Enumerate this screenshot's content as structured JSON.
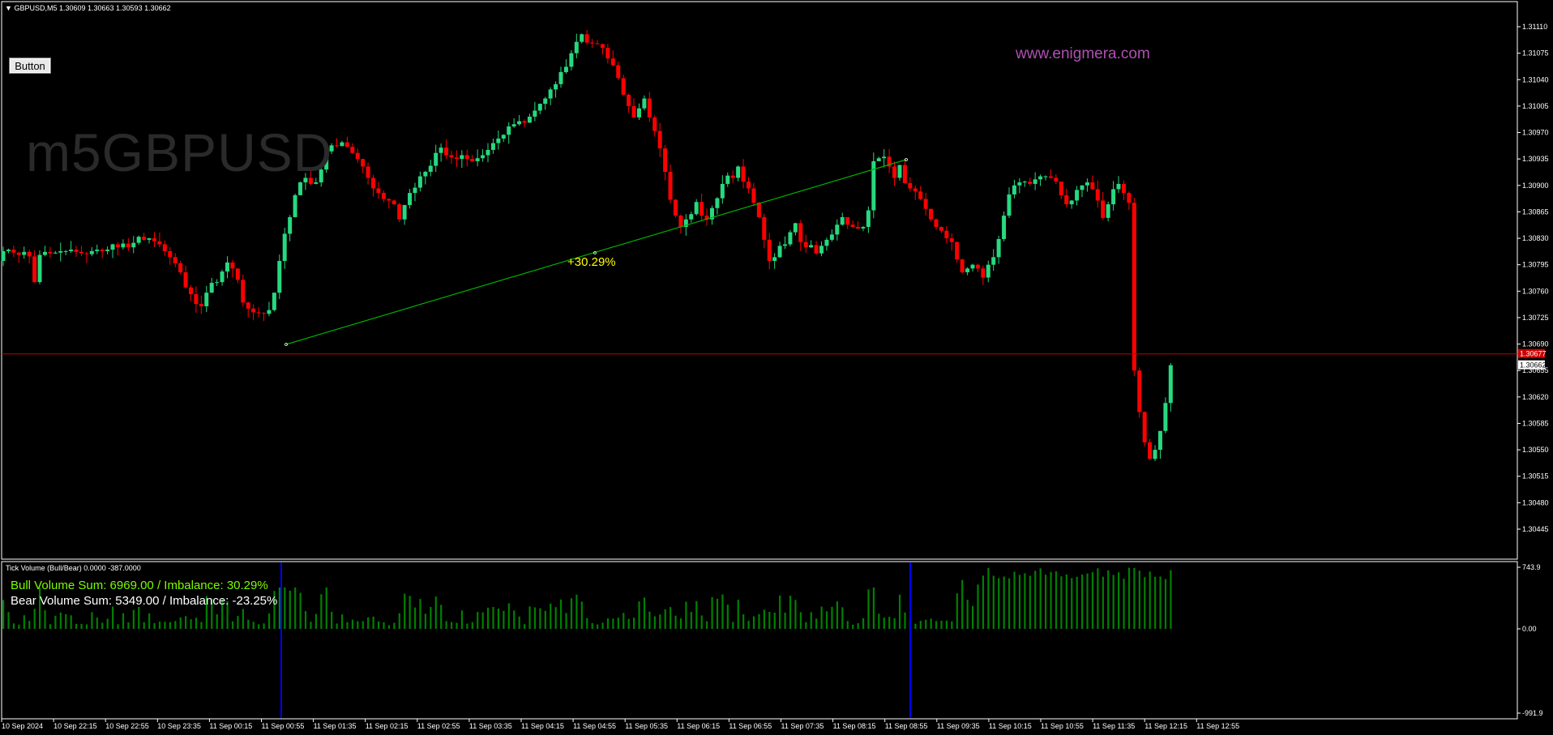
{
  "header": {
    "menu_arrow": "▼",
    "symbol": "GBPUSD,M5",
    "ohlc": "1.30609 1.30663 1.30593 1.30662"
  },
  "button_label": "Button",
  "watermark": "m5GBPUSD",
  "website": "www.enigmera.com",
  "imbalance_annotation": "+30.29%",
  "price_scale": {
    "ticks": [
      "1.31110",
      "1.31075",
      "1.31040",
      "1.31005",
      "1.30970",
      "1.30935",
      "1.30900",
      "1.30865",
      "1.30830",
      "1.30795",
      "1.30760",
      "1.30725",
      "1.30690",
      "1.30655",
      "1.30620",
      "1.30585",
      "1.30550",
      "1.30515",
      "1.30480",
      "1.30445"
    ],
    "ask_label": "1.30677",
    "bid_label": "1.30662"
  },
  "time_axis": [
    "10 Sep 2024",
    "10 Sep 22:15",
    "10 Sep 22:55",
    "10 Sep 23:35",
    "11 Sep 00:15",
    "11 Sep 00:55",
    "11 Sep 01:35",
    "11 Sep 02:15",
    "11 Sep 02:55",
    "11 Sep 03:35",
    "11 Sep 04:15",
    "11 Sep 04:55",
    "11 Sep 05:35",
    "11 Sep 06:15",
    "11 Sep 06:55",
    "11 Sep 07:35",
    "11 Sep 08:15",
    "11 Sep 08:55",
    "11 Sep 09:35",
    "11 Sep 10:15",
    "11 Sep 10:55",
    "11 Sep 11:35",
    "11 Sep 12:15",
    "11 Sep 12:55"
  ],
  "indicator": {
    "header": "Tick Volume (Bull/Bear) 0.0000 -387.0000",
    "bull_text": "Bull Volume Sum: 6969.00 / Imbalance: 30.29%",
    "bear_text": "Bear Volume Sum: 5349.00 / Imbalance: -23.25%",
    "scale": [
      "743.9",
      "0.00",
      "-991.9"
    ]
  },
  "colors": {
    "bull": "#26d97f",
    "bear": "#ff0000",
    "vol_bull": "#008000",
    "vol_bear": "#ff0000",
    "trendline": "#00b000",
    "price_line": "#c00000",
    "annotation": "#ffff00",
    "marker_line": "#0000ff"
  },
  "chart_data": [
    {
      "type": "candlestick",
      "symbol": "GBPUSD",
      "timeframe": "M5",
      "ylim": [
        1.30445,
        1.3112
      ],
      "closes": [
        1.30813,
        1.30815,
        1.30811,
        1.30808,
        1.30812,
        1.30806,
        1.30772,
        1.30808,
        1.30812,
        1.3081,
        1.30811,
        1.30813,
        1.30813,
        1.30815,
        1.30812,
        1.3081,
        1.30809,
        1.30813,
        1.30815,
        1.30813,
        1.30815,
        1.30822,
        1.30818,
        1.30823,
        1.30818,
        1.30824,
        1.30832,
        1.30828,
        1.3083,
        1.30826,
        1.30822,
        1.30813,
        1.30805,
        1.30797,
        1.30785,
        1.30765,
        1.30756,
        1.30743,
        1.3074,
        1.30758,
        1.30771,
        1.30772,
        1.30786,
        1.30798,
        1.3079,
        1.30775,
        1.30745,
        1.30737,
        1.30732,
        1.30731,
        1.3073,
        1.30735,
        1.30758,
        1.308,
        1.30836,
        1.30858,
        1.30887,
        1.30904,
        1.3091,
        1.30902,
        1.30904,
        1.30921,
        1.30945,
        1.30953,
        1.30952,
        1.30957,
        1.30951,
        1.30943,
        1.30935,
        1.30925,
        1.3091,
        1.30896,
        1.3089,
        1.30882,
        1.3088,
        1.30875,
        1.30855,
        1.30874,
        1.3089,
        1.30897,
        1.30912,
        1.30918,
        1.30926,
        1.30943,
        1.3095,
        1.3094,
        1.30937,
        1.30935,
        1.3094,
        1.30935,
        1.30932,
        1.30936,
        1.3094,
        1.30947,
        1.30956,
        1.30962,
        1.30967,
        1.30978,
        1.30981,
        1.30985,
        1.30983,
        1.30991,
        1.30999,
        1.31008,
        1.31015,
        1.31027,
        1.31034,
        1.3105,
        1.31057,
        1.31075,
        1.3109,
        1.311,
        1.31089,
        1.31088,
        1.31087,
        1.31082,
        1.31068,
        1.31059,
        1.31042,
        1.3102,
        1.31005,
        1.3099,
        1.31002,
        1.31015,
        1.3099,
        1.30972,
        1.30949,
        1.30918,
        1.30881,
        1.3086,
        1.30845,
        1.30855,
        1.30862,
        1.30878,
        1.3086,
        1.30855,
        1.3087,
        1.30883,
        1.30902,
        1.30913,
        1.3091,
        1.30925,
        1.30905,
        1.30896,
        1.30877,
        1.30858,
        1.30828,
        1.308,
        1.30805,
        1.3082,
        1.30822,
        1.30838,
        1.3085,
        1.30825,
        1.30818,
        1.30821,
        1.3081,
        1.3082,
        1.30828,
        1.30835,
        1.30848,
        1.30858,
        1.30848,
        1.30845,
        1.30843,
        1.30845,
        1.30867,
        1.30932,
        1.30936,
        1.30938,
        1.30925,
        1.3091,
        1.30927,
        1.30903,
        1.30896,
        1.30892,
        1.30882,
        1.30869,
        1.30855,
        1.30845,
        1.3084,
        1.3083,
        1.30825,
        1.30802,
        1.30785,
        1.3079,
        1.30795,
        1.3079,
        1.30778,
        1.30795,
        1.30805,
        1.30829,
        1.3086,
        1.30888,
        1.309,
        1.30904,
        1.30905,
        1.30902,
        1.30908,
        1.30912,
        1.30912,
        1.3091,
        1.30905,
        1.30887,
        1.30875,
        1.3088,
        1.30894,
        1.309,
        1.30904,
        1.30895,
        1.3088,
        1.30857,
        1.30875,
        1.30895,
        1.30902,
        1.3089,
        1.30877,
        1.30655,
        1.306,
        1.3056,
        1.30538,
        1.3055,
        1.30575,
        1.30612,
        1.30662
      ],
      "annotations": [
        {
          "text": "+30.29%",
          "kind": "trendline"
        }
      ],
      "reference_lines": [
        1.30677
      ],
      "current_price": 1.30662
    },
    {
      "type": "bar",
      "title": "Tick Volume (Bull/Bear)",
      "ylim": [
        -991.9,
        743.9
      ],
      "bull_volume_sum": 6969.0,
      "bear_volume_sum": 5349.0,
      "bull_imbalance_pct": 30.29,
      "bear_imbalance_pct": -23.25,
      "last_values": [
        0.0,
        -387.0
      ]
    }
  ]
}
